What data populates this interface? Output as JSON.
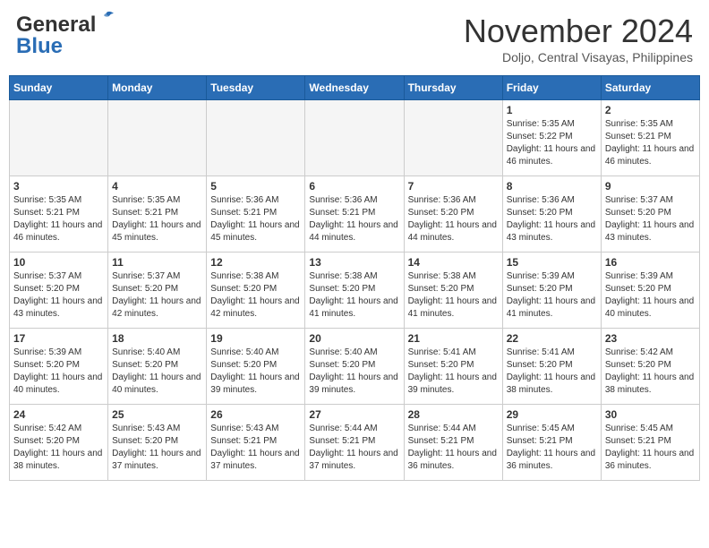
{
  "header": {
    "logo_line1": "General",
    "logo_line2": "Blue",
    "month_title": "November 2024",
    "location": "Doljo, Central Visayas, Philippines"
  },
  "weekdays": [
    "Sunday",
    "Monday",
    "Tuesday",
    "Wednesday",
    "Thursday",
    "Friday",
    "Saturday"
  ],
  "weeks": [
    [
      {
        "day": "",
        "info": ""
      },
      {
        "day": "",
        "info": ""
      },
      {
        "day": "",
        "info": ""
      },
      {
        "day": "",
        "info": ""
      },
      {
        "day": "",
        "info": ""
      },
      {
        "day": "1",
        "info": "Sunrise: 5:35 AM\nSunset: 5:22 PM\nDaylight: 11 hours and 46 minutes."
      },
      {
        "day": "2",
        "info": "Sunrise: 5:35 AM\nSunset: 5:21 PM\nDaylight: 11 hours and 46 minutes."
      }
    ],
    [
      {
        "day": "3",
        "info": "Sunrise: 5:35 AM\nSunset: 5:21 PM\nDaylight: 11 hours and 46 minutes."
      },
      {
        "day": "4",
        "info": "Sunrise: 5:35 AM\nSunset: 5:21 PM\nDaylight: 11 hours and 45 minutes."
      },
      {
        "day": "5",
        "info": "Sunrise: 5:36 AM\nSunset: 5:21 PM\nDaylight: 11 hours and 45 minutes."
      },
      {
        "day": "6",
        "info": "Sunrise: 5:36 AM\nSunset: 5:21 PM\nDaylight: 11 hours and 44 minutes."
      },
      {
        "day": "7",
        "info": "Sunrise: 5:36 AM\nSunset: 5:20 PM\nDaylight: 11 hours and 44 minutes."
      },
      {
        "day": "8",
        "info": "Sunrise: 5:36 AM\nSunset: 5:20 PM\nDaylight: 11 hours and 43 minutes."
      },
      {
        "day": "9",
        "info": "Sunrise: 5:37 AM\nSunset: 5:20 PM\nDaylight: 11 hours and 43 minutes."
      }
    ],
    [
      {
        "day": "10",
        "info": "Sunrise: 5:37 AM\nSunset: 5:20 PM\nDaylight: 11 hours and 43 minutes."
      },
      {
        "day": "11",
        "info": "Sunrise: 5:37 AM\nSunset: 5:20 PM\nDaylight: 11 hours and 42 minutes."
      },
      {
        "day": "12",
        "info": "Sunrise: 5:38 AM\nSunset: 5:20 PM\nDaylight: 11 hours and 42 minutes."
      },
      {
        "day": "13",
        "info": "Sunrise: 5:38 AM\nSunset: 5:20 PM\nDaylight: 11 hours and 41 minutes."
      },
      {
        "day": "14",
        "info": "Sunrise: 5:38 AM\nSunset: 5:20 PM\nDaylight: 11 hours and 41 minutes."
      },
      {
        "day": "15",
        "info": "Sunrise: 5:39 AM\nSunset: 5:20 PM\nDaylight: 11 hours and 41 minutes."
      },
      {
        "day": "16",
        "info": "Sunrise: 5:39 AM\nSunset: 5:20 PM\nDaylight: 11 hours and 40 minutes."
      }
    ],
    [
      {
        "day": "17",
        "info": "Sunrise: 5:39 AM\nSunset: 5:20 PM\nDaylight: 11 hours and 40 minutes."
      },
      {
        "day": "18",
        "info": "Sunrise: 5:40 AM\nSunset: 5:20 PM\nDaylight: 11 hours and 40 minutes."
      },
      {
        "day": "19",
        "info": "Sunrise: 5:40 AM\nSunset: 5:20 PM\nDaylight: 11 hours and 39 minutes."
      },
      {
        "day": "20",
        "info": "Sunrise: 5:40 AM\nSunset: 5:20 PM\nDaylight: 11 hours and 39 minutes."
      },
      {
        "day": "21",
        "info": "Sunrise: 5:41 AM\nSunset: 5:20 PM\nDaylight: 11 hours and 39 minutes."
      },
      {
        "day": "22",
        "info": "Sunrise: 5:41 AM\nSunset: 5:20 PM\nDaylight: 11 hours and 38 minutes."
      },
      {
        "day": "23",
        "info": "Sunrise: 5:42 AM\nSunset: 5:20 PM\nDaylight: 11 hours and 38 minutes."
      }
    ],
    [
      {
        "day": "24",
        "info": "Sunrise: 5:42 AM\nSunset: 5:20 PM\nDaylight: 11 hours and 38 minutes."
      },
      {
        "day": "25",
        "info": "Sunrise: 5:43 AM\nSunset: 5:20 PM\nDaylight: 11 hours and 37 minutes."
      },
      {
        "day": "26",
        "info": "Sunrise: 5:43 AM\nSunset: 5:21 PM\nDaylight: 11 hours and 37 minutes."
      },
      {
        "day": "27",
        "info": "Sunrise: 5:44 AM\nSunset: 5:21 PM\nDaylight: 11 hours and 37 minutes."
      },
      {
        "day": "28",
        "info": "Sunrise: 5:44 AM\nSunset: 5:21 PM\nDaylight: 11 hours and 36 minutes."
      },
      {
        "day": "29",
        "info": "Sunrise: 5:45 AM\nSunset: 5:21 PM\nDaylight: 11 hours and 36 minutes."
      },
      {
        "day": "30",
        "info": "Sunrise: 5:45 AM\nSunset: 5:21 PM\nDaylight: 11 hours and 36 minutes."
      }
    ]
  ]
}
